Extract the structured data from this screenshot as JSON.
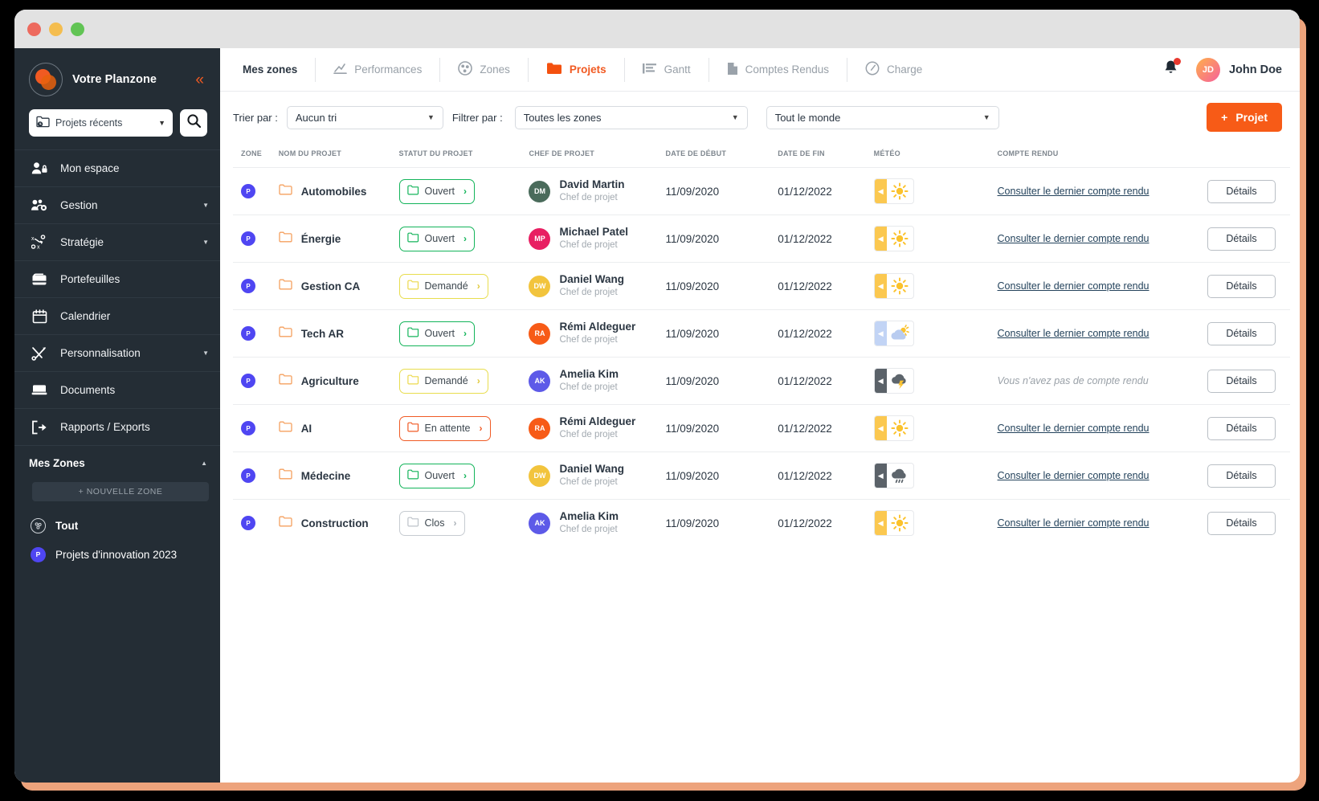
{
  "window": {
    "traffic_lights": [
      "close",
      "minimize",
      "maximize"
    ]
  },
  "sidebar": {
    "brand": "Votre Planzone",
    "collapse_icon": "chevrons-left-icon",
    "recent_select": {
      "label": "Projets récents",
      "icon": "folder-clock-icon"
    },
    "search_icon": "search-icon",
    "items": [
      {
        "label": "Mon espace",
        "icon": "user-lock-icon",
        "caret": false
      },
      {
        "label": "Gestion",
        "icon": "users-gear-icon",
        "caret": true
      },
      {
        "label": "Stratégie",
        "icon": "strategy-icon",
        "caret": true
      },
      {
        "label": "Portefeuilles",
        "icon": "wallet-icon",
        "caret": false
      },
      {
        "label": "Calendrier",
        "icon": "calendar-icon",
        "caret": false
      },
      {
        "label": "Personnalisation",
        "icon": "tools-icon",
        "caret": true
      },
      {
        "label": "Documents",
        "icon": "documents-icon",
        "caret": false
      },
      {
        "label": "Rapports / Exports",
        "icon": "export-icon",
        "caret": false
      }
    ],
    "zones_section": {
      "title": "Mes Zones",
      "new_zone_label": "+ NOUVELLE ZONE",
      "zones": [
        {
          "label": "Tout",
          "badge": "",
          "type": "all"
        },
        {
          "label": "Projets d'innovation 2023",
          "badge": "P",
          "type": "zone"
        }
      ]
    }
  },
  "topnav": {
    "tabs": [
      {
        "label": "Mes zones",
        "icon": "",
        "state": "title"
      },
      {
        "label": "Performances",
        "icon": "chart-line-icon",
        "state": "normal"
      },
      {
        "label": "Zones",
        "icon": "zones-icon",
        "state": "normal"
      },
      {
        "label": "Projets",
        "icon": "folder-icon",
        "state": "active"
      },
      {
        "label": "Gantt",
        "icon": "gantt-icon",
        "state": "normal"
      },
      {
        "label": "Comptes Rendus",
        "icon": "file-icon",
        "state": "normal"
      },
      {
        "label": "Charge",
        "icon": "gauge-icon",
        "state": "normal"
      }
    ],
    "bell_icon": "bell-icon",
    "user": {
      "initials": "JD",
      "name": "John Doe"
    }
  },
  "toolbar": {
    "sort_label": "Trier par :",
    "sort_value": "Aucun tri",
    "filter_label": "Filtrer par :",
    "zone_value": "Toutes les zones",
    "people_value": "Tout le monde",
    "new_project_label": "Projet",
    "new_project_icon": "plus-icon"
  },
  "table": {
    "headers": [
      "ZONE",
      "NOM DU PROJET",
      "STATUT DU PROJET",
      "CHEF DE PROJET",
      "DATE DE DÉBUT",
      "DATE DE FIN",
      "MÉTÉO",
      "COMPTE RENDU",
      ""
    ],
    "cr_link_label": "Consulter le dernier compte rendu",
    "cr_empty_label": "Vous n'avez pas de compte rendu",
    "details_label": "Détails",
    "rows": [
      {
        "zone_badge": "P",
        "name": "Automobiles",
        "status": "Ouvert",
        "status_kind": "ouvert",
        "chef": "David Martin",
        "chef_initials": "DM",
        "chef_color": "#4a6b5b",
        "role": "Chef de projet",
        "start": "11/09/2020",
        "end": "01/12/2022",
        "weather": "sun",
        "weather_color": "#fbc850",
        "cr": "link"
      },
      {
        "zone_badge": "P",
        "name": "Énergie",
        "status": "Ouvert",
        "status_kind": "ouvert",
        "chef": "Michael Patel",
        "chef_initials": "MP",
        "chef_color": "#e81f62",
        "role": "Chef de projet",
        "start": "11/09/2020",
        "end": "01/12/2022",
        "weather": "sun",
        "weather_color": "#fbc850",
        "cr": "link"
      },
      {
        "zone_badge": "P",
        "name": "Gestion CA",
        "status": "Demandé",
        "status_kind": "demande",
        "chef": "Daniel Wang",
        "chef_initials": "DW",
        "chef_color": "#f2c43d",
        "role": "Chef de projet",
        "start": "11/09/2020",
        "end": "01/12/2022",
        "weather": "sun",
        "weather_color": "#fbc850",
        "cr": "link"
      },
      {
        "zone_badge": "P",
        "name": "Tech AR",
        "status": "Ouvert",
        "status_kind": "ouvert",
        "chef": "Rémi Aldeguer",
        "chef_initials": "RA",
        "chef_color": "#f75b17",
        "role": "Chef de projet",
        "start": "11/09/2020",
        "end": "01/12/2022",
        "weather": "partly-cloudy",
        "weather_color": "#c2d4f5",
        "cr": "link"
      },
      {
        "zone_badge": "P",
        "name": "Agriculture",
        "status": "Demandé",
        "status_kind": "demande",
        "chef": "Amelia Kim",
        "chef_initials": "AK",
        "chef_color": "#5d5ae8",
        "role": "Chef de projet",
        "start": "11/09/2020",
        "end": "01/12/2022",
        "weather": "thunder",
        "weather_color": "#5b6269",
        "cr": "empty"
      },
      {
        "zone_badge": "P",
        "name": "AI",
        "status": "En attente",
        "status_kind": "attente",
        "chef": "Rémi Aldeguer",
        "chef_initials": "RA",
        "chef_color": "#f75b17",
        "role": "Chef de projet",
        "start": "11/09/2020",
        "end": "01/12/2022",
        "weather": "sun",
        "weather_color": "#fbc850",
        "cr": "link"
      },
      {
        "zone_badge": "P",
        "name": "Médecine",
        "status": "Ouvert",
        "status_kind": "ouvert",
        "chef": "Daniel Wang",
        "chef_initials": "DW",
        "chef_color": "#f2c43d",
        "role": "Chef de projet",
        "start": "11/09/2020",
        "end": "01/12/2022",
        "weather": "rain",
        "weather_color": "#5b6269",
        "cr": "link"
      },
      {
        "zone_badge": "P",
        "name": "Construction",
        "status": "Clos",
        "status_kind": "clos",
        "chef": "Amelia Kim",
        "chef_initials": "AK",
        "chef_color": "#5d5ae8",
        "role": "Chef de projet",
        "start": "11/09/2020",
        "end": "01/12/2022",
        "weather": "sun",
        "weather_color": "#fbc850",
        "cr": "link"
      }
    ]
  }
}
